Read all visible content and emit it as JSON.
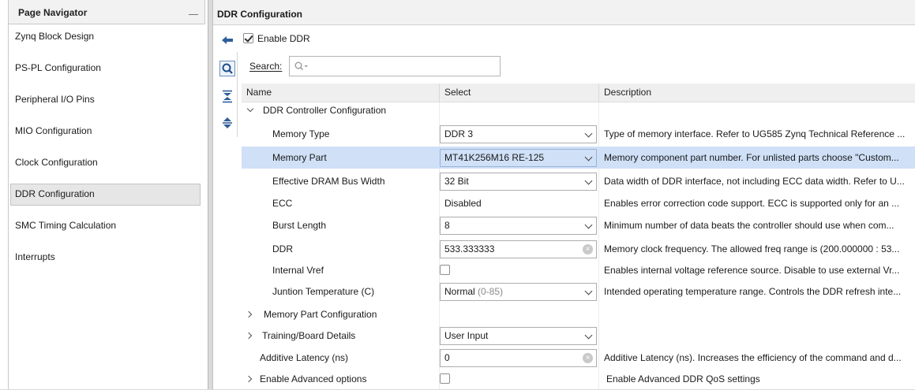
{
  "navigator": {
    "title": "Page Navigator",
    "items": [
      {
        "label": "Zynq Block Design"
      },
      {
        "label": "PS-PL Configuration"
      },
      {
        "label": "Peripheral I/O Pins"
      },
      {
        "label": "MIO Configuration"
      },
      {
        "label": "Clock Configuration"
      },
      {
        "label": "DDR Configuration",
        "selected": true
      },
      {
        "label": "SMC Timing Calculation"
      },
      {
        "label": "Interrupts"
      }
    ]
  },
  "main": {
    "title": "DDR Configuration",
    "enable_ddr": {
      "label": "Enable DDR",
      "checked": true
    },
    "search": {
      "label": "Search:",
      "value": ""
    },
    "columns": {
      "name": "Name",
      "select": "Select",
      "description": "Description"
    },
    "group": {
      "label": "DDR Controller Configuration"
    },
    "rows": {
      "memory_type": {
        "name": "Memory Type",
        "value": "DDR 3",
        "description": "Type of memory interface. Refer to UG585 Zynq Technical Reference ..."
      },
      "memory_part": {
        "name": "Memory Part",
        "value": "MT41K256M16 RE-125",
        "description": "Memory component part number. For unlisted parts choose \"Custom..."
      },
      "bus_width": {
        "name": "Effective DRAM Bus Width",
        "value": "32 Bit",
        "description": "Data width of DDR interface, not including ECC data width. Refer to U..."
      },
      "ecc": {
        "name": "ECC",
        "value": "Disabled",
        "description": "Enables error correction code support. ECC is supported only for an ..."
      },
      "burst_length": {
        "name": "Burst Length",
        "value": "8",
        "description": "Minimum number of data beats the controller should use when com..."
      },
      "ddr": {
        "name": "DDR",
        "value": "533.333333",
        "description": "Memory clock frequency. The allowed freq range is (200.000000 : 53..."
      },
      "internal_vref": {
        "name": "Internal Vref",
        "checked": false,
        "description": "Enables internal voltage reference source. Disable to use external Vr..."
      },
      "temperature": {
        "name": "Juntion Temperature (C)",
        "value": "Normal",
        "value_hint": "(0-85)",
        "description": "Intended operating temperature range. Controls the DDR refresh inte..."
      },
      "memory_part_config": {
        "name": "Memory Part Configuration"
      },
      "training": {
        "name": "Training/Board Details",
        "value": "User Input"
      },
      "additive_latency": {
        "name": "Additive Latency (ns)",
        "value": "0",
        "description": "Additive Latency (ns). Increases the efficiency of the command and d..."
      },
      "advanced": {
        "name": "Enable Advanced options",
        "checked": false,
        "description": "Enable Advanced DDR QoS settings"
      }
    }
  },
  "icons": [
    "back-arrow-icon",
    "search-icon",
    "collapse-all-icon",
    "expand-all-icon",
    "clear-icon",
    "chevron-down-icon",
    "chevron-right-icon",
    "checkmark-icon"
  ],
  "colors": {
    "selected_row": "#cfe0f7",
    "header_bg": "#efefef",
    "nav_selected": "#e6e6e6"
  }
}
